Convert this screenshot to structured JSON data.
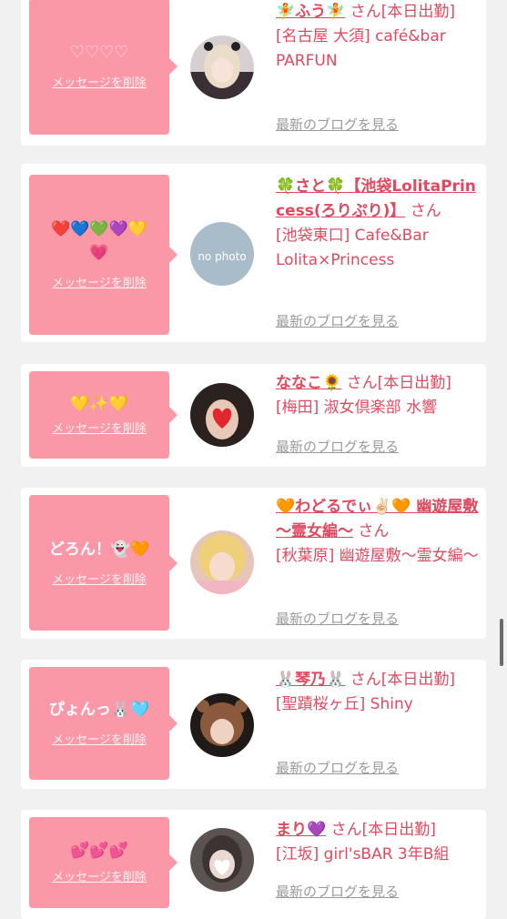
{
  "common": {
    "delete_label": "メッセージを削除",
    "blog_label": "最新のブログを見る"
  },
  "items": [
    {
      "message": "♡♡♡♡",
      "name": "🧚ふう🧚",
      "suffix": "さん[本日出勤]",
      "shop": "[名古屋 大須] café&bar PARFUN",
      "avatar": "photo-girl-twintails"
    },
    {
      "message": "❤️💙💚💜💛💗",
      "name": "🍀さと🍀【池袋LolitaPrincess(ろりぷり)】",
      "suffix": "さん",
      "shop": "[池袋東口] Cafe&Bar Lolita×Princess",
      "avatar_text": "no photo"
    },
    {
      "message": "💛✨💛",
      "name": "ななこ🌻",
      "suffix": "さん[本日出勤]",
      "shop": "[梅田] 淑女倶楽部 水響",
      "avatar": "photo-heart-face"
    },
    {
      "message": "どろん！👻🧡",
      "name": "🧡わどるでぃ✌🏻🧡 幽遊屋敷 〜霊女編〜",
      "suffix": "さん",
      "shop": "[秋葉原] 幽遊屋敷〜霊女編〜",
      "avatar": "photo-blonde-girl"
    },
    {
      "message": "ぴょんっ🐰🩵",
      "name": "🐰琴乃🐰",
      "suffix": "さん[本日出勤]",
      "shop": "[聖蹟桜ヶ丘] Shiny",
      "avatar": "photo-animal-hood"
    },
    {
      "message": "💕💕💕",
      "name": "まり💜",
      "suffix": "さん[本日出勤]",
      "shop": "[江坂] girl'sBAR 3年B組",
      "avatar": "photo-heart-mask"
    }
  ]
}
